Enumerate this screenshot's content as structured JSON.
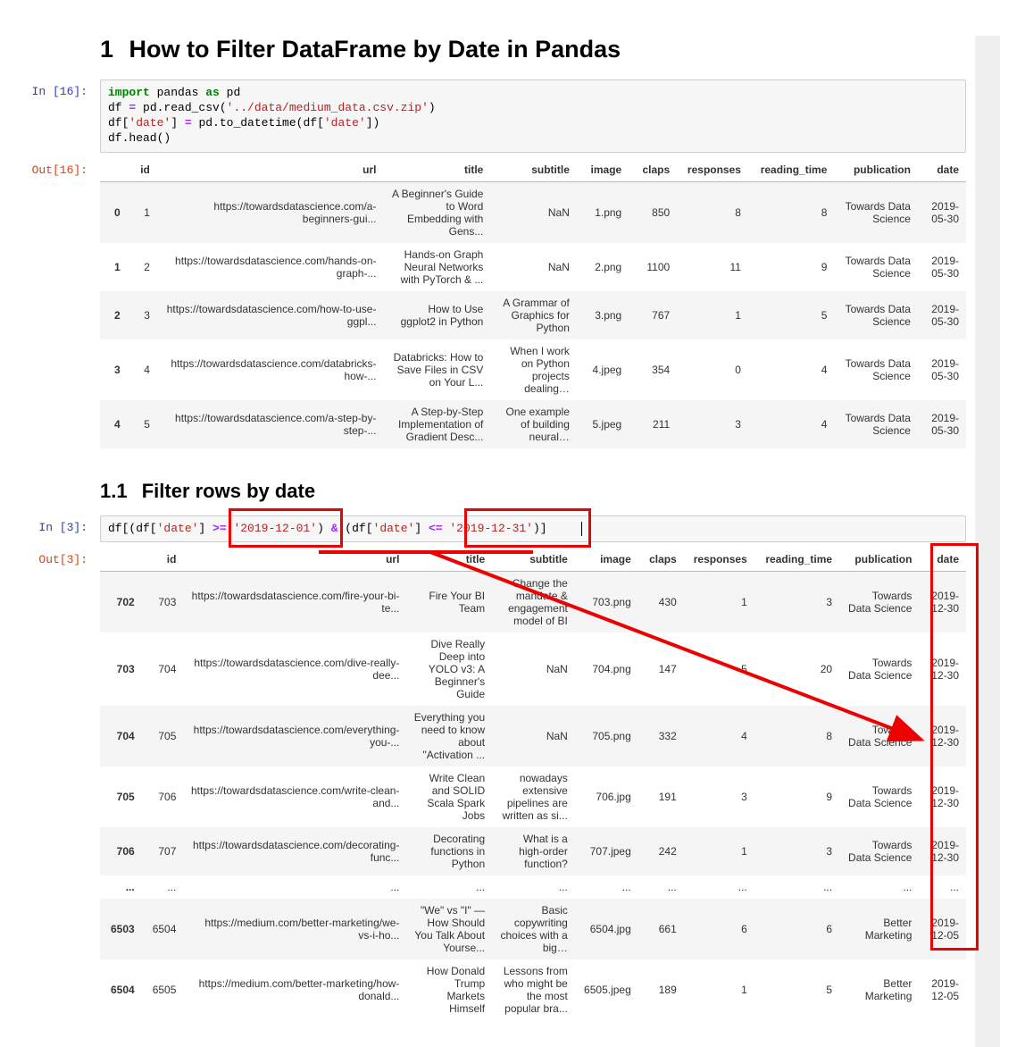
{
  "heading1_num": "1",
  "heading1_text": "How to Filter DataFrame by Date in Pandas",
  "heading2_num": "1.1",
  "heading2_text": "Filter rows by date",
  "cell1": {
    "in_prompt": "In [16]:",
    "out_prompt": "Out[16]:",
    "code": {
      "t1": "import",
      "t2": " pandas ",
      "t3": "as",
      "t4": " pd\n",
      "t5": "df ",
      "t6": "=",
      "t7": " pd.read_csv(",
      "t8": "'../data/medium_data.csv.zip'",
      "t9": ")\n",
      "t10": "df[",
      "t11": "'date'",
      "t12": "] ",
      "t13": "=",
      "t14": " pd.to_datetime(df[",
      "t15": "'date'",
      "t16": "])\n",
      "t17": "df.head()"
    }
  },
  "cell2": {
    "in_prompt": "In [3]:",
    "out_prompt": "Out[3]:",
    "code": {
      "c1": "df[(df[",
      "c2": "'date'",
      "c3": "] ",
      "c4": ">=",
      "c5": " ",
      "c6": "'2019-12-01'",
      "c7": ") ",
      "c8": "&",
      "c9": " (df[",
      "c10": "'date'",
      "c11": "] ",
      "c12": "<=",
      "c13": " ",
      "c14": "'2019-12-31'",
      "c15": ")]"
    }
  },
  "table1": {
    "headers": [
      "",
      "id",
      "url",
      "title",
      "subtitle",
      "image",
      "claps",
      "responses",
      "reading_time",
      "publication",
      "date"
    ],
    "rows": [
      {
        "idx": "0",
        "id": "1",
        "url": "https://towardsdatascience.com/a-beginners-gui...",
        "title": "A Beginner's Guide to Word Embedding with Gens...",
        "subtitle": "NaN",
        "image": "1.png",
        "claps": "850",
        "responses": "8",
        "reading_time": "8",
        "publication": "Towards Data Science",
        "date": "2019-05-30"
      },
      {
        "idx": "1",
        "id": "2",
        "url": "https://towardsdatascience.com/hands-on-graph-...",
        "title": "Hands-on Graph Neural Networks with PyTorch & ...",
        "subtitle": "NaN",
        "image": "2.png",
        "claps": "1100",
        "responses": "11",
        "reading_time": "9",
        "publication": "Towards Data Science",
        "date": "2019-05-30"
      },
      {
        "idx": "2",
        "id": "3",
        "url": "https://towardsdatascience.com/how-to-use-ggpl...",
        "title": "How to Use ggplot2 in Python",
        "subtitle": "A Grammar of Graphics for Python",
        "image": "3.png",
        "claps": "767",
        "responses": "1",
        "reading_time": "5",
        "publication": "Towards Data Science",
        "date": "2019-05-30"
      },
      {
        "idx": "3",
        "id": "4",
        "url": "https://towardsdatascience.com/databricks-how-...",
        "title": "Databricks: How to Save Files in CSV on Your L...",
        "subtitle": "When I work on Python projects dealing…",
        "image": "4.jpeg",
        "claps": "354",
        "responses": "0",
        "reading_time": "4",
        "publication": "Towards Data Science",
        "date": "2019-05-30"
      },
      {
        "idx": "4",
        "id": "5",
        "url": "https://towardsdatascience.com/a-step-by-step-...",
        "title": "A Step-by-Step Implementation of Gradient Desc...",
        "subtitle": "One example of building neural…",
        "image": "5.jpeg",
        "claps": "211",
        "responses": "3",
        "reading_time": "4",
        "publication": "Towards Data Science",
        "date": "2019-05-30"
      }
    ]
  },
  "table2": {
    "headers": [
      "",
      "id",
      "url",
      "title",
      "subtitle",
      "image",
      "claps",
      "responses",
      "reading_time",
      "publication",
      "date"
    ],
    "rows": [
      {
        "idx": "702",
        "id": "703",
        "url": "https://towardsdatascience.com/fire-your-bi-te...",
        "title": "Fire Your BI Team",
        "subtitle": "Change the mandate & engagement model of BI",
        "image": "703.png",
        "claps": "430",
        "responses": "1",
        "reading_time": "3",
        "publication": "Towards Data Science",
        "date": "2019-12-30"
      },
      {
        "idx": "703",
        "id": "704",
        "url": "https://towardsdatascience.com/dive-really-dee...",
        "title": "Dive Really Deep into YOLO v3: A Beginner's Guide",
        "subtitle": "NaN",
        "image": "704.png",
        "claps": "147",
        "responses": "5",
        "reading_time": "20",
        "publication": "Towards Data Science",
        "date": "2019-12-30"
      },
      {
        "idx": "704",
        "id": "705",
        "url": "https://towardsdatascience.com/everything-you-...",
        "title": "Everything you need to know about \"Activation ...",
        "subtitle": "NaN",
        "image": "705.png",
        "claps": "332",
        "responses": "4",
        "reading_time": "8",
        "publication": "Towards Data Science",
        "date": "2019-12-30"
      },
      {
        "idx": "705",
        "id": "706",
        "url": "https://towardsdatascience.com/write-clean-and...",
        "title": "Write Clean and SOLID Scala Spark Jobs",
        "subtitle": "nowadays extensive pipelines are written as si...",
        "image": "706.jpg",
        "claps": "191",
        "responses": "3",
        "reading_time": "9",
        "publication": "Towards Data Science",
        "date": "2019-12-30"
      },
      {
        "idx": "706",
        "id": "707",
        "url": "https://towardsdatascience.com/decorating-func...",
        "title": "Decorating functions in Python",
        "subtitle": "What is a high-order function?",
        "image": "707.jpeg",
        "claps": "242",
        "responses": "1",
        "reading_time": "3",
        "publication": "Towards Data Science",
        "date": "2019-12-30"
      },
      {
        "idx": "...",
        "id": "...",
        "url": "...",
        "title": "...",
        "subtitle": "...",
        "image": "...",
        "claps": "...",
        "responses": "...",
        "reading_time": "...",
        "publication": "...",
        "date": "..."
      },
      {
        "idx": "6503",
        "id": "6504",
        "url": "https://medium.com/better-marketing/we-vs-i-ho...",
        "title": "\"We\" vs \"I\" — How Should You Talk About Yourse...",
        "subtitle": "Basic copywriting choices with a big…",
        "image": "6504.jpg",
        "claps": "661",
        "responses": "6",
        "reading_time": "6",
        "publication": "Better Marketing",
        "date": "2019-12-05"
      },
      {
        "idx": "6504",
        "id": "6505",
        "url": "https://medium.com/better-marketing/how-donald...",
        "title": "How Donald Trump Markets Himself",
        "subtitle": "Lessons from who might be the most popular bra...",
        "image": "6505.jpeg",
        "claps": "189",
        "responses": "1",
        "reading_time": "5",
        "publication": "Better Marketing",
        "date": "2019-12-05"
      }
    ]
  },
  "colwidths1": [
    "28",
    "28",
    "250",
    "140",
    "130",
    "55",
    "50",
    "70",
    "90",
    "100",
    "50"
  ],
  "colwidths2": [
    "40",
    "40",
    "240",
    "130",
    "100",
    "60",
    "45",
    "70",
    "90",
    "95",
    "50"
  ]
}
